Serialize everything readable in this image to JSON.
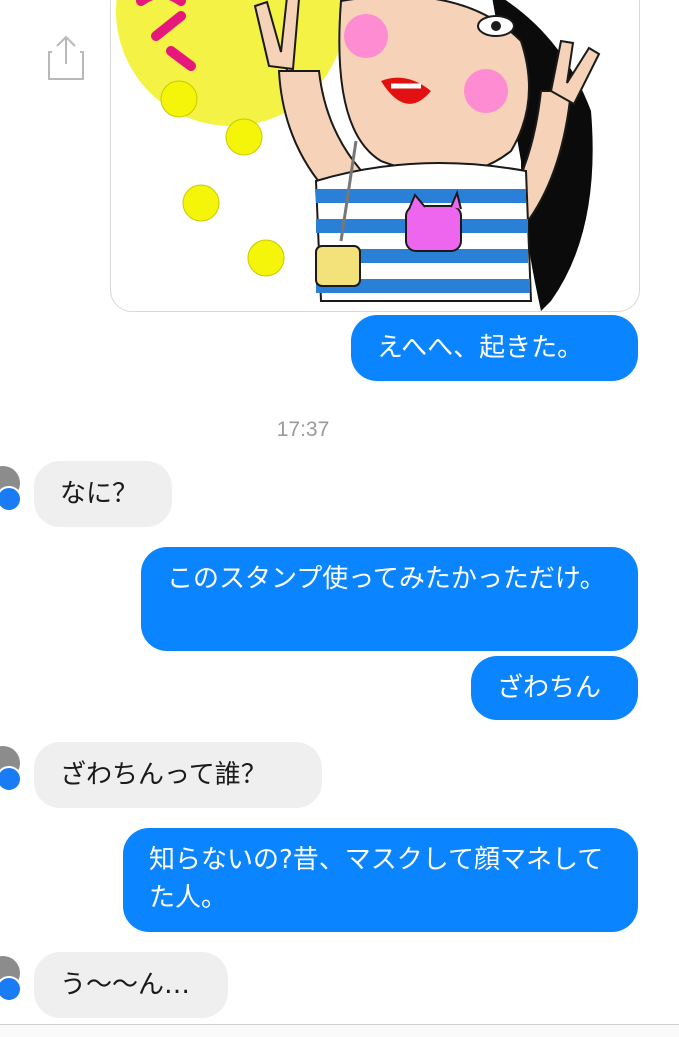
{
  "colors": {
    "outgoing": "#0a84ff",
    "incoming": "#efefef",
    "timestamp": "#9a9a9a",
    "messenger_badge": "#1a7cf5"
  },
  "icons": {
    "share": "share-icon",
    "avatar_badge": "messenger-bolt-icon"
  },
  "timestamp": "17:37",
  "messages": [
    {
      "id": "m1",
      "from": "me",
      "text": "えへへ、起きた。"
    },
    {
      "id": "m2",
      "from": "them",
      "text": "なに？"
    },
    {
      "id": "m3",
      "from": "me",
      "text": "このスタンプ使ってみたかっただけ。"
    },
    {
      "id": "m4",
      "from": "me",
      "text": "ざわちん"
    },
    {
      "id": "m5",
      "from": "them",
      "text": "ざわちんって誰？"
    },
    {
      "id": "m6",
      "from": "me",
      "text": "知らないの?昔、マスクして顔マネしてた人。"
    },
    {
      "id": "m7",
      "from": "them",
      "text": "う〜〜ん…"
    }
  ]
}
